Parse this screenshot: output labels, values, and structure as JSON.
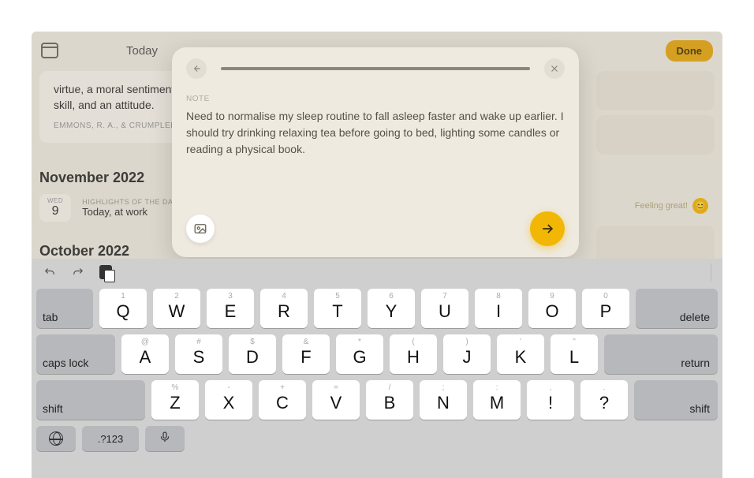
{
  "topbar": {
    "today_label": "Today",
    "done_label": "Done"
  },
  "background": {
    "quote_text": "virtue, a moral sentiment, a motive, a coping response, a skill, and an attitude.",
    "quote_author": "EMMONS, R. A., & CRUMPLER, C. A",
    "month_nov": "November 2022",
    "month_oct": "October 2022",
    "day_dow": "WED",
    "day_num": "9",
    "highlights_label": "HIGHLIGHTS OF THE DAY",
    "highlights_text": "Today, at work",
    "feeling_text": "Feeling great!",
    "feeling_emoji": "😊"
  },
  "modal": {
    "note_label": "NOTE",
    "note_text": "Need to normalise my sleep routine to fall asleep faster and wake up earlier. I should try drinking relaxing tea before going to bed, lighting some candles or reading a physical book."
  },
  "keyboard": {
    "tab": "tab",
    "delete": "delete",
    "caps": "caps lock",
    "return": "return",
    "shift": "shift",
    "num_toggle": ".?123",
    "row1": [
      {
        "pri": "Q",
        "sec": "1"
      },
      {
        "pri": "W",
        "sec": "2"
      },
      {
        "pri": "E",
        "sec": "3"
      },
      {
        "pri": "R",
        "sec": "4"
      },
      {
        "pri": "T",
        "sec": "5"
      },
      {
        "pri": "Y",
        "sec": "6"
      },
      {
        "pri": "U",
        "sec": "7"
      },
      {
        "pri": "I",
        "sec": "8"
      },
      {
        "pri": "O",
        "sec": "9"
      },
      {
        "pri": "P",
        "sec": "0"
      }
    ],
    "row2": [
      {
        "pri": "A",
        "sec": "@"
      },
      {
        "pri": "S",
        "sec": "#"
      },
      {
        "pri": "D",
        "sec": "$"
      },
      {
        "pri": "F",
        "sec": "&"
      },
      {
        "pri": "G",
        "sec": "*"
      },
      {
        "pri": "H",
        "sec": "("
      },
      {
        "pri": "J",
        "sec": ")"
      },
      {
        "pri": "K",
        "sec": "'"
      },
      {
        "pri": "L",
        "sec": "\""
      }
    ],
    "row3": [
      {
        "pri": "Z",
        "sec": "%"
      },
      {
        "pri": "X",
        "sec": "-"
      },
      {
        "pri": "C",
        "sec": "+"
      },
      {
        "pri": "V",
        "sec": "="
      },
      {
        "pri": "B",
        "sec": "/"
      },
      {
        "pri": "N",
        "sec": ";"
      },
      {
        "pri": "M",
        "sec": ":"
      },
      {
        "pri": "!",
        "sec": ","
      },
      {
        "pri": "?",
        "sec": "."
      }
    ]
  }
}
